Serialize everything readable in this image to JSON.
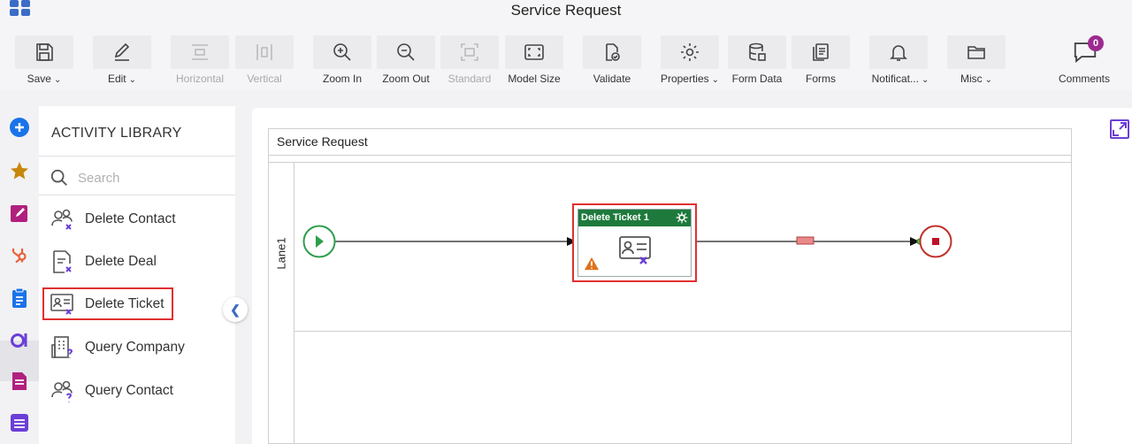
{
  "window": {
    "title": "Service Request"
  },
  "toolbar": {
    "save": "Save",
    "edit": "Edit",
    "horizontal": "Horizontal",
    "vertical": "Vertical",
    "zoom_in": "Zoom In",
    "zoom_out": "Zoom Out",
    "standard": "Standard",
    "model_size": "Model Size",
    "validate": "Validate",
    "properties": "Properties",
    "form_data": "Form Data",
    "forms": "Forms",
    "notifications": "Notificat...",
    "misc": "Misc",
    "comments": "Comments",
    "comments_count": "0"
  },
  "library": {
    "title": "ACTIVITY LIBRARY",
    "search_placeholder": "Search",
    "items": [
      {
        "label": "Delete Contact",
        "icon": "delete-contact-icon"
      },
      {
        "label": "Delete Deal",
        "icon": "delete-deal-icon"
      },
      {
        "label": "Delete Ticket",
        "icon": "delete-ticket-icon",
        "selected": true
      },
      {
        "label": "Query Company",
        "icon": "query-company-icon"
      },
      {
        "label": "Query Contact",
        "icon": "query-contact-icon"
      }
    ]
  },
  "canvas": {
    "pool_title": "Service Request",
    "lane_label": "Lane1",
    "task_title": "Delete Ticket 1"
  },
  "colors": {
    "accent": "#3b6cc6",
    "task_header": "#1e7a3c",
    "highlight": "#e03030",
    "start": "#2e9e4a",
    "end": "#c0302a",
    "badge": "#9c2a8f"
  }
}
